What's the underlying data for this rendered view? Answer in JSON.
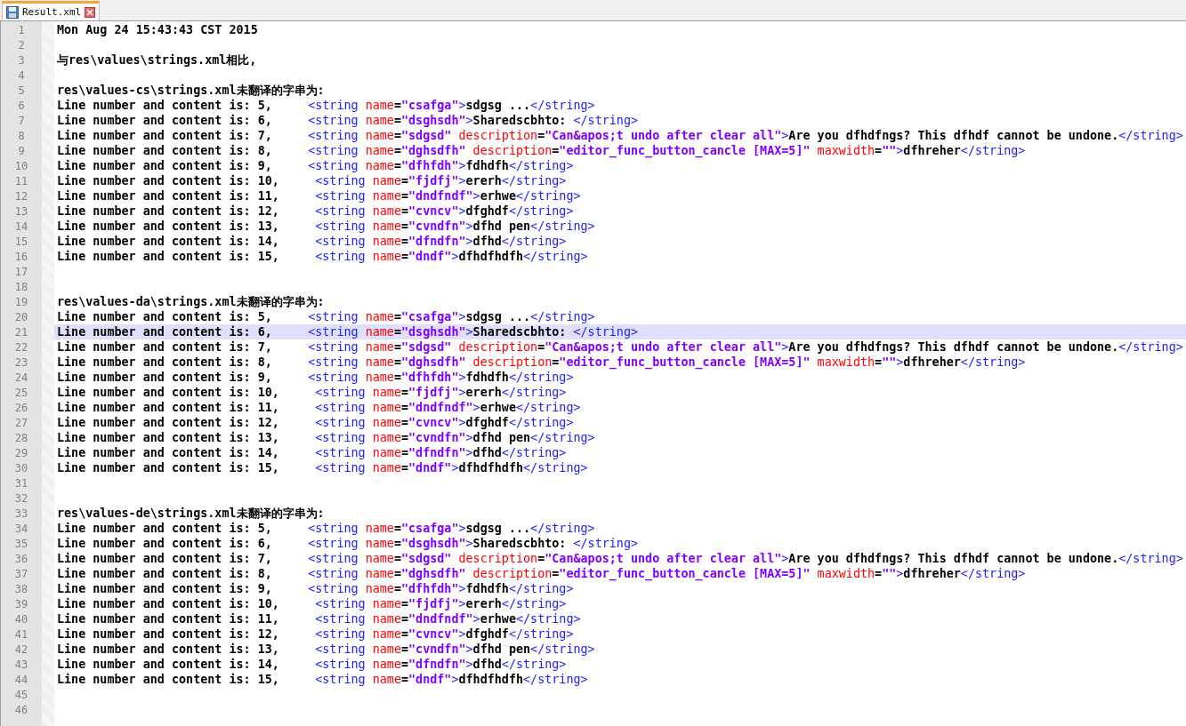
{
  "tabs": [
    {
      "label": "Result.xml",
      "selected": true
    }
  ],
  "lines": [
    {
      "number": "1",
      "current": false,
      "tokens": [
        {
          "kind": "text",
          "text": "Mon Aug 24 15:43:43 CST 2015"
        }
      ]
    },
    {
      "number": "2",
      "current": false
    },
    {
      "number": "3",
      "current": false,
      "tokens": [
        {
          "kind": "text",
          "text": "与res\\values\\strings.xml相比,"
        }
      ]
    },
    {
      "number": "4",
      "current": false
    },
    {
      "number": "5",
      "current": false,
      "tokens": [
        {
          "kind": "text",
          "text": "res\\values-cs\\strings.xml未翻译的字串为:"
        }
      ]
    },
    {
      "number": "6",
      "current": false,
      "tokens": [
        {
          "kind": "text",
          "text": "Line number and content is: 5,     "
        },
        {
          "kind": "tag",
          "text": "<string"
        },
        {
          "kind": "attr",
          "text": " name"
        },
        {
          "kind": "text",
          "text": "="
        },
        {
          "kind": "value",
          "text": "\"csafga\""
        },
        {
          "kind": "tag",
          "text": ">"
        },
        {
          "kind": "text",
          "text": "sdgsg ..."
        },
        {
          "kind": "tag",
          "text": "</string>"
        }
      ]
    },
    {
      "number": "7",
      "current": false,
      "tokens": [
        {
          "kind": "text",
          "text": "Line number and content is: 6,     "
        },
        {
          "kind": "tag",
          "text": "<string"
        },
        {
          "kind": "attr",
          "text": " name"
        },
        {
          "kind": "text",
          "text": "="
        },
        {
          "kind": "value",
          "text": "\"dsghsdh\""
        },
        {
          "kind": "tag",
          "text": ">"
        },
        {
          "kind": "text",
          "text": "Sharedscbhto: "
        },
        {
          "kind": "tag",
          "text": "</string>"
        }
      ]
    },
    {
      "number": "8",
      "current": false,
      "tokens": [
        {
          "kind": "text",
          "text": "Line number and content is: 7,     "
        },
        {
          "kind": "tag",
          "text": "<string"
        },
        {
          "kind": "attr",
          "text": " name"
        },
        {
          "kind": "text",
          "text": "="
        },
        {
          "kind": "value",
          "text": "\"sdgsd\""
        },
        {
          "kind": "attr",
          "text": " description"
        },
        {
          "kind": "text",
          "text": "="
        },
        {
          "kind": "value",
          "text": "\"Can&apos;t undo after clear all\""
        },
        {
          "kind": "tag",
          "text": ">"
        },
        {
          "kind": "text",
          "text": "Are you dfhdfngs? This dfhdf cannot be undone."
        },
        {
          "kind": "tag",
          "text": "</string>"
        }
      ]
    },
    {
      "number": "9",
      "current": false,
      "tokens": [
        {
          "kind": "text",
          "text": "Line number and content is: 8,     "
        },
        {
          "kind": "tag",
          "text": "<string"
        },
        {
          "kind": "attr",
          "text": " name"
        },
        {
          "kind": "text",
          "text": "="
        },
        {
          "kind": "value",
          "text": "\"dghsdfh\""
        },
        {
          "kind": "attr",
          "text": " description"
        },
        {
          "kind": "text",
          "text": "="
        },
        {
          "kind": "value",
          "text": "\"editor_func_button_cancle [MAX=5]\""
        },
        {
          "kind": "attr",
          "text": " maxwidth"
        },
        {
          "kind": "text",
          "text": "="
        },
        {
          "kind": "value",
          "text": "\"\""
        },
        {
          "kind": "tag",
          "text": ">"
        },
        {
          "kind": "text",
          "text": "dfhreher"
        },
        {
          "kind": "tag",
          "text": "</string>"
        }
      ]
    },
    {
      "number": "10",
      "current": false,
      "tokens": [
        {
          "kind": "text",
          "text": "Line number and content is: 9,     "
        },
        {
          "kind": "tag",
          "text": "<string"
        },
        {
          "kind": "attr",
          "text": " name"
        },
        {
          "kind": "text",
          "text": "="
        },
        {
          "kind": "value",
          "text": "\"dfhfdh\""
        },
        {
          "kind": "tag",
          "text": ">"
        },
        {
          "kind": "text",
          "text": "fdhdfh"
        },
        {
          "kind": "tag",
          "text": "</string>"
        }
      ]
    },
    {
      "number": "11",
      "current": false,
      "tokens": [
        {
          "kind": "text",
          "text": "Line number and content is: 10,     "
        },
        {
          "kind": "tag",
          "text": "<string"
        },
        {
          "kind": "attr",
          "text": " name"
        },
        {
          "kind": "text",
          "text": "="
        },
        {
          "kind": "value",
          "text": "\"fjdfj\""
        },
        {
          "kind": "tag",
          "text": ">"
        },
        {
          "kind": "text",
          "text": "ererh"
        },
        {
          "kind": "tag",
          "text": "</string>"
        }
      ]
    },
    {
      "number": "12",
      "current": false,
      "tokens": [
        {
          "kind": "text",
          "text": "Line number and content is: 11,     "
        },
        {
          "kind": "tag",
          "text": "<string"
        },
        {
          "kind": "attr",
          "text": " name"
        },
        {
          "kind": "text",
          "text": "="
        },
        {
          "kind": "value",
          "text": "\"dndfndf\""
        },
        {
          "kind": "tag",
          "text": ">"
        },
        {
          "kind": "text",
          "text": "erhwe"
        },
        {
          "kind": "tag",
          "text": "</string>"
        }
      ]
    },
    {
      "number": "13",
      "current": false,
      "tokens": [
        {
          "kind": "text",
          "text": "Line number and content is: 12,     "
        },
        {
          "kind": "tag",
          "text": "<string"
        },
        {
          "kind": "attr",
          "text": " name"
        },
        {
          "kind": "text",
          "text": "="
        },
        {
          "kind": "value",
          "text": "\"cvncv\""
        },
        {
          "kind": "tag",
          "text": ">"
        },
        {
          "kind": "text",
          "text": "dfghdf"
        },
        {
          "kind": "tag",
          "text": "</string>"
        }
      ]
    },
    {
      "number": "14",
      "current": false,
      "tokens": [
        {
          "kind": "text",
          "text": "Line number and content is: 13,     "
        },
        {
          "kind": "tag",
          "text": "<string"
        },
        {
          "kind": "attr",
          "text": " name"
        },
        {
          "kind": "text",
          "text": "="
        },
        {
          "kind": "value",
          "text": "\"cvndfn\""
        },
        {
          "kind": "tag",
          "text": ">"
        },
        {
          "kind": "text",
          "text": "dfhd pen"
        },
        {
          "kind": "tag",
          "text": "</string>"
        }
      ]
    },
    {
      "number": "15",
      "current": false,
      "tokens": [
        {
          "kind": "text",
          "text": "Line number and content is: 14,     "
        },
        {
          "kind": "tag",
          "text": "<string"
        },
        {
          "kind": "attr",
          "text": " name"
        },
        {
          "kind": "text",
          "text": "="
        },
        {
          "kind": "value",
          "text": "\"dfndfn\""
        },
        {
          "kind": "tag",
          "text": ">"
        },
        {
          "kind": "text",
          "text": "dfhd"
        },
        {
          "kind": "tag",
          "text": "</string>"
        }
      ]
    },
    {
      "number": "16",
      "current": false,
      "tokens": [
        {
          "kind": "text",
          "text": "Line number and content is: 15,     "
        },
        {
          "kind": "tag",
          "text": "<string"
        },
        {
          "kind": "attr",
          "text": " name"
        },
        {
          "kind": "text",
          "text": "="
        },
        {
          "kind": "value",
          "text": "\"dndf\""
        },
        {
          "kind": "tag",
          "text": ">"
        },
        {
          "kind": "text",
          "text": "dfhdfhdfh"
        },
        {
          "kind": "tag",
          "text": "</string>"
        }
      ]
    },
    {
      "number": "17",
      "current": false
    },
    {
      "number": "18",
      "current": false
    },
    {
      "number": "19",
      "current": false,
      "tokens": [
        {
          "kind": "text",
          "text": "res\\values-da\\strings.xml未翻译的字串为:"
        }
      ]
    },
    {
      "number": "20",
      "current": false,
      "tokens": [
        {
          "kind": "text",
          "text": "Line number and content is: 5,     "
        },
        {
          "kind": "tag",
          "text": "<string"
        },
        {
          "kind": "attr",
          "text": " name"
        },
        {
          "kind": "text",
          "text": "="
        },
        {
          "kind": "value",
          "text": "\"csafga\""
        },
        {
          "kind": "tag",
          "text": ">"
        },
        {
          "kind": "text",
          "text": "sdgsg ..."
        },
        {
          "kind": "tag",
          "text": "</string>"
        }
      ]
    },
    {
      "number": "21",
      "current": true,
      "tokens": [
        {
          "kind": "text",
          "text": "Line number and content is: 6,     "
        },
        {
          "kind": "tag",
          "text": "<string"
        },
        {
          "kind": "attr",
          "text": " name"
        },
        {
          "kind": "text",
          "text": "="
        },
        {
          "kind": "value",
          "text": "\"dsghsdh\""
        },
        {
          "kind": "tag",
          "text": ">"
        },
        {
          "kind": "text",
          "text": "Sharedscbhto: "
        },
        {
          "kind": "tag",
          "text": "</string>"
        }
      ]
    },
    {
      "number": "22",
      "current": false,
      "tokens": [
        {
          "kind": "text",
          "text": "Line number and content is: 7,     "
        },
        {
          "kind": "tag",
          "text": "<string"
        },
        {
          "kind": "attr",
          "text": " name"
        },
        {
          "kind": "text",
          "text": "="
        },
        {
          "kind": "value",
          "text": "\"sdgsd\""
        },
        {
          "kind": "attr",
          "text": " description"
        },
        {
          "kind": "text",
          "text": "="
        },
        {
          "kind": "value",
          "text": "\"Can&apos;t undo after clear all\""
        },
        {
          "kind": "tag",
          "text": ">"
        },
        {
          "kind": "text",
          "text": "Are you dfhdfngs? This dfhdf cannot be undone."
        },
        {
          "kind": "tag",
          "text": "</string>"
        }
      ]
    },
    {
      "number": "23",
      "current": false,
      "tokens": [
        {
          "kind": "text",
          "text": "Line number and content is: 8,     "
        },
        {
          "kind": "tag",
          "text": "<string"
        },
        {
          "kind": "attr",
          "text": " name"
        },
        {
          "kind": "text",
          "text": "="
        },
        {
          "kind": "value",
          "text": "\"dghsdfh\""
        },
        {
          "kind": "attr",
          "text": " description"
        },
        {
          "kind": "text",
          "text": "="
        },
        {
          "kind": "value",
          "text": "\"editor_func_button_cancle [MAX=5]\""
        },
        {
          "kind": "attr",
          "text": " maxwidth"
        },
        {
          "kind": "text",
          "text": "="
        },
        {
          "kind": "value",
          "text": "\"\""
        },
        {
          "kind": "tag",
          "text": ">"
        },
        {
          "kind": "text",
          "text": "dfhreher"
        },
        {
          "kind": "tag",
          "text": "</string>"
        }
      ]
    },
    {
      "number": "24",
      "current": false,
      "tokens": [
        {
          "kind": "text",
          "text": "Line number and content is: 9,     "
        },
        {
          "kind": "tag",
          "text": "<string"
        },
        {
          "kind": "attr",
          "text": " name"
        },
        {
          "kind": "text",
          "text": "="
        },
        {
          "kind": "value",
          "text": "\"dfhfdh\""
        },
        {
          "kind": "tag",
          "text": ">"
        },
        {
          "kind": "text",
          "text": "fdhdfh"
        },
        {
          "kind": "tag",
          "text": "</string>"
        }
      ]
    },
    {
      "number": "25",
      "current": false,
      "tokens": [
        {
          "kind": "text",
          "text": "Line number and content is: 10,     "
        },
        {
          "kind": "tag",
          "text": "<string"
        },
        {
          "kind": "attr",
          "text": " name"
        },
        {
          "kind": "text",
          "text": "="
        },
        {
          "kind": "value",
          "text": "\"fjdfj\""
        },
        {
          "kind": "tag",
          "text": ">"
        },
        {
          "kind": "text",
          "text": "ererh"
        },
        {
          "kind": "tag",
          "text": "</string>"
        }
      ]
    },
    {
      "number": "26",
      "current": false,
      "tokens": [
        {
          "kind": "text",
          "text": "Line number and content is: 11,     "
        },
        {
          "kind": "tag",
          "text": "<string"
        },
        {
          "kind": "attr",
          "text": " name"
        },
        {
          "kind": "text",
          "text": "="
        },
        {
          "kind": "value",
          "text": "\"dndfndf\""
        },
        {
          "kind": "tag",
          "text": ">"
        },
        {
          "kind": "text",
          "text": "erhwe"
        },
        {
          "kind": "tag",
          "text": "</string>"
        }
      ]
    },
    {
      "number": "27",
      "current": false,
      "tokens": [
        {
          "kind": "text",
          "text": "Line number and content is: 12,     "
        },
        {
          "kind": "tag",
          "text": "<string"
        },
        {
          "kind": "attr",
          "text": " name"
        },
        {
          "kind": "text",
          "text": "="
        },
        {
          "kind": "value",
          "text": "\"cvncv\""
        },
        {
          "kind": "tag",
          "text": ">"
        },
        {
          "kind": "text",
          "text": "dfghdf"
        },
        {
          "kind": "tag",
          "text": "</string>"
        }
      ]
    },
    {
      "number": "28",
      "current": false,
      "tokens": [
        {
          "kind": "text",
          "text": "Line number and content is: 13,     "
        },
        {
          "kind": "tag",
          "text": "<string"
        },
        {
          "kind": "attr",
          "text": " name"
        },
        {
          "kind": "text",
          "text": "="
        },
        {
          "kind": "value",
          "text": "\"cvndfn\""
        },
        {
          "kind": "tag",
          "text": ">"
        },
        {
          "kind": "text",
          "text": "dfhd pen"
        },
        {
          "kind": "tag",
          "text": "</string>"
        }
      ]
    },
    {
      "number": "29",
      "current": false,
      "tokens": [
        {
          "kind": "text",
          "text": "Line number and content is: 14,     "
        },
        {
          "kind": "tag",
          "text": "<string"
        },
        {
          "kind": "attr",
          "text": " name"
        },
        {
          "kind": "text",
          "text": "="
        },
        {
          "kind": "value",
          "text": "\"dfndfn\""
        },
        {
          "kind": "tag",
          "text": ">"
        },
        {
          "kind": "text",
          "text": "dfhd"
        },
        {
          "kind": "tag",
          "text": "</string>"
        }
      ]
    },
    {
      "number": "30",
      "current": false,
      "tokens": [
        {
          "kind": "text",
          "text": "Line number and content is: 15,     "
        },
        {
          "kind": "tag",
          "text": "<string"
        },
        {
          "kind": "attr",
          "text": " name"
        },
        {
          "kind": "text",
          "text": "="
        },
        {
          "kind": "value",
          "text": "\"dndf\""
        },
        {
          "kind": "tag",
          "text": ">"
        },
        {
          "kind": "text",
          "text": "dfhdfhdfh"
        },
        {
          "kind": "tag",
          "text": "</string>"
        }
      ]
    },
    {
      "number": "31",
      "current": false
    },
    {
      "number": "32",
      "current": false
    },
    {
      "number": "33",
      "current": false,
      "tokens": [
        {
          "kind": "text",
          "text": "res\\values-de\\strings.xml未翻译的字串为:"
        }
      ]
    },
    {
      "number": "34",
      "current": false,
      "tokens": [
        {
          "kind": "text",
          "text": "Line number and content is: 5,     "
        },
        {
          "kind": "tag",
          "text": "<string"
        },
        {
          "kind": "attr",
          "text": " name"
        },
        {
          "kind": "text",
          "text": "="
        },
        {
          "kind": "value",
          "text": "\"csafga\""
        },
        {
          "kind": "tag",
          "text": ">"
        },
        {
          "kind": "text",
          "text": "sdgsg ..."
        },
        {
          "kind": "tag",
          "text": "</string>"
        }
      ]
    },
    {
      "number": "35",
      "current": false,
      "tokens": [
        {
          "kind": "text",
          "text": "Line number and content is: 6,     "
        },
        {
          "kind": "tag",
          "text": "<string"
        },
        {
          "kind": "attr",
          "text": " name"
        },
        {
          "kind": "text",
          "text": "="
        },
        {
          "kind": "value",
          "text": "\"dsghsdh\""
        },
        {
          "kind": "tag",
          "text": ">"
        },
        {
          "kind": "text",
          "text": "Sharedscbhto: "
        },
        {
          "kind": "tag",
          "text": "</string>"
        }
      ]
    },
    {
      "number": "36",
      "current": false,
      "tokens": [
        {
          "kind": "text",
          "text": "Line number and content is: 7,     "
        },
        {
          "kind": "tag",
          "text": "<string"
        },
        {
          "kind": "attr",
          "text": " name"
        },
        {
          "kind": "text",
          "text": "="
        },
        {
          "kind": "value",
          "text": "\"sdgsd\""
        },
        {
          "kind": "attr",
          "text": " description"
        },
        {
          "kind": "text",
          "text": "="
        },
        {
          "kind": "value",
          "text": "\"Can&apos;t undo after clear all\""
        },
        {
          "kind": "tag",
          "text": ">"
        },
        {
          "kind": "text",
          "text": "Are you dfhdfngs? This dfhdf cannot be undone."
        },
        {
          "kind": "tag",
          "text": "</string>"
        }
      ]
    },
    {
      "number": "37",
      "current": false,
      "tokens": [
        {
          "kind": "text",
          "text": "Line number and content is: 8,     "
        },
        {
          "kind": "tag",
          "text": "<string"
        },
        {
          "kind": "attr",
          "text": " name"
        },
        {
          "kind": "text",
          "text": "="
        },
        {
          "kind": "value",
          "text": "\"dghsdfh\""
        },
        {
          "kind": "attr",
          "text": " description"
        },
        {
          "kind": "text",
          "text": "="
        },
        {
          "kind": "value",
          "text": "\"editor_func_button_cancle [MAX=5]\""
        },
        {
          "kind": "attr",
          "text": " maxwidth"
        },
        {
          "kind": "text",
          "text": "="
        },
        {
          "kind": "value",
          "text": "\"\""
        },
        {
          "kind": "tag",
          "text": ">"
        },
        {
          "kind": "text",
          "text": "dfhreher"
        },
        {
          "kind": "tag",
          "text": "</string>"
        }
      ]
    },
    {
      "number": "38",
      "current": false,
      "tokens": [
        {
          "kind": "text",
          "text": "Line number and content is: 9,     "
        },
        {
          "kind": "tag",
          "text": "<string"
        },
        {
          "kind": "attr",
          "text": " name"
        },
        {
          "kind": "text",
          "text": "="
        },
        {
          "kind": "value",
          "text": "\"dfhfdh\""
        },
        {
          "kind": "tag",
          "text": ">"
        },
        {
          "kind": "text",
          "text": "fdhdfh"
        },
        {
          "kind": "tag",
          "text": "</string>"
        }
      ]
    },
    {
      "number": "39",
      "current": false,
      "tokens": [
        {
          "kind": "text",
          "text": "Line number and content is: 10,     "
        },
        {
          "kind": "tag",
          "text": "<string"
        },
        {
          "kind": "attr",
          "text": " name"
        },
        {
          "kind": "text",
          "text": "="
        },
        {
          "kind": "value",
          "text": "\"fjdfj\""
        },
        {
          "kind": "tag",
          "text": ">"
        },
        {
          "kind": "text",
          "text": "ererh"
        },
        {
          "kind": "tag",
          "text": "</string>"
        }
      ]
    },
    {
      "number": "40",
      "current": false,
      "tokens": [
        {
          "kind": "text",
          "text": "Line number and content is: 11,     "
        },
        {
          "kind": "tag",
          "text": "<string"
        },
        {
          "kind": "attr",
          "text": " name"
        },
        {
          "kind": "text",
          "text": "="
        },
        {
          "kind": "value",
          "text": "\"dndfndf\""
        },
        {
          "kind": "tag",
          "text": ">"
        },
        {
          "kind": "text",
          "text": "erhwe"
        },
        {
          "kind": "tag",
          "text": "</string>"
        }
      ]
    },
    {
      "number": "41",
      "current": false,
      "tokens": [
        {
          "kind": "text",
          "text": "Line number and content is: 12,     "
        },
        {
          "kind": "tag",
          "text": "<string"
        },
        {
          "kind": "attr",
          "text": " name"
        },
        {
          "kind": "text",
          "text": "="
        },
        {
          "kind": "value",
          "text": "\"cvncv\""
        },
        {
          "kind": "tag",
          "text": ">"
        },
        {
          "kind": "text",
          "text": "dfghdf"
        },
        {
          "kind": "tag",
          "text": "</string>"
        }
      ]
    },
    {
      "number": "42",
      "current": false,
      "tokens": [
        {
          "kind": "text",
          "text": "Line number and content is: 13,     "
        },
        {
          "kind": "tag",
          "text": "<string"
        },
        {
          "kind": "attr",
          "text": " name"
        },
        {
          "kind": "text",
          "text": "="
        },
        {
          "kind": "value",
          "text": "\"cvndfn\""
        },
        {
          "kind": "tag",
          "text": ">"
        },
        {
          "kind": "text",
          "text": "dfhd pen"
        },
        {
          "kind": "tag",
          "text": "</string>"
        }
      ]
    },
    {
      "number": "43",
      "current": false,
      "tokens": [
        {
          "kind": "text",
          "text": "Line number and content is: 14,     "
        },
        {
          "kind": "tag",
          "text": "<string"
        },
        {
          "kind": "attr",
          "text": " name"
        },
        {
          "kind": "text",
          "text": "="
        },
        {
          "kind": "value",
          "text": "\"dfndfn\""
        },
        {
          "kind": "tag",
          "text": ">"
        },
        {
          "kind": "text",
          "text": "dfhd"
        },
        {
          "kind": "tag",
          "text": "</string>"
        }
      ]
    },
    {
      "number": "44",
      "current": false,
      "tokens": [
        {
          "kind": "text",
          "text": "Line number and content is: 15,     "
        },
        {
          "kind": "tag",
          "text": "<string"
        },
        {
          "kind": "attr",
          "text": " name"
        },
        {
          "kind": "text",
          "text": "="
        },
        {
          "kind": "value",
          "text": "\"dndf\""
        },
        {
          "kind": "tag",
          "text": ">"
        },
        {
          "kind": "text",
          "text": "dfhdfhdfh"
        },
        {
          "kind": "tag",
          "text": "</string>"
        }
      ]
    },
    {
      "number": "45",
      "current": false
    },
    {
      "number": "46",
      "current": false
    }
  ]
}
